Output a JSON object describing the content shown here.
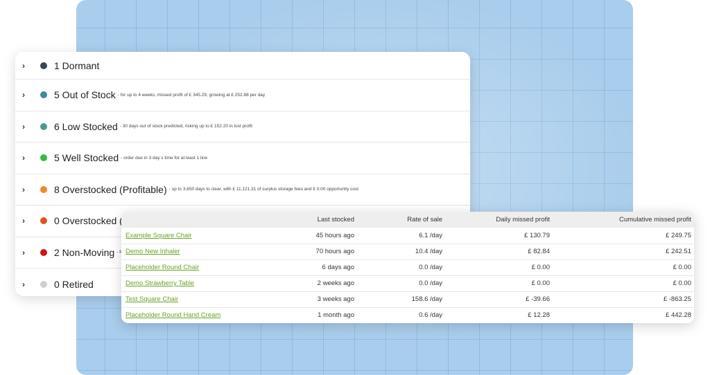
{
  "status_groups": [
    {
      "label": "1 Dormant",
      "note": "",
      "color": "#3b4557"
    },
    {
      "label": "5 Out of Stock",
      "note": "- for up to 4 weeks, missed profit of £ 345.29, growing at £ 252.88 per day",
      "color": "#3f8a9a"
    },
    {
      "label": "6 Low Stocked",
      "note": "- 30 days out of stock predicted, risking up to £ 152.20 in lost profit",
      "color": "#4a9a8c"
    },
    {
      "label": "5 Well Stocked",
      "note": "- order due in 3 day s time for at least 1 line",
      "color": "#2dbd3f"
    },
    {
      "label": "8 Overstocked (Profitable)",
      "note": "- up to 3,650 days to clear, with £ 11,121.31 of surplus storage fees and £ 0.00 opportunity cost",
      "color": "#f0892a"
    },
    {
      "label": "0 Overstocked (L",
      "note": "",
      "color": "#e0531c"
    },
    {
      "label": "2 Non-Moving",
      "note": "- fo",
      "color": "#cc1515"
    },
    {
      "label": "0 Retired",
      "note": "",
      "color": "#cfcfcf"
    }
  ],
  "detail_table": {
    "headers": [
      "",
      "Last stocked",
      "Rate of sale",
      "Daily missed profit",
      "Cumulative missed profit"
    ],
    "rows": [
      {
        "name": "Example Square Chair",
        "last": "45 hours ago",
        "rate": "6.1 /day",
        "daily": "£ 130.79",
        "cumulative": "£ 249.75"
      },
      {
        "name": "Demo New Inhaler",
        "last": "70 hours ago",
        "rate": "10.4 /day",
        "daily": "£ 82.84",
        "cumulative": "£ 242.51"
      },
      {
        "name": "Placeholder Round Chair",
        "last": "6 days ago",
        "rate": "0.0 /day",
        "daily": "£ 0.00",
        "cumulative": "£ 0.00"
      },
      {
        "name": "Demo Strawberry Table",
        "last": "2 weeks ago",
        "rate": "0.0 /day",
        "daily": "£ 0.00",
        "cumulative": "£ 0.00"
      },
      {
        "name": "Test Square Chair",
        "last": "3 weeks ago",
        "rate": "158.6 /day",
        "daily": "£ -39.66",
        "cumulative": "£ -863.25"
      },
      {
        "name": "Placeholder Round Hand Cream",
        "last": "1 month ago",
        "rate": "0.6 /day",
        "daily": "£ 12.28",
        "cumulative": "£ 442.28"
      }
    ]
  },
  "icons": {
    "expand": "chevron-right-icon",
    "status": "status-dot-icon"
  }
}
